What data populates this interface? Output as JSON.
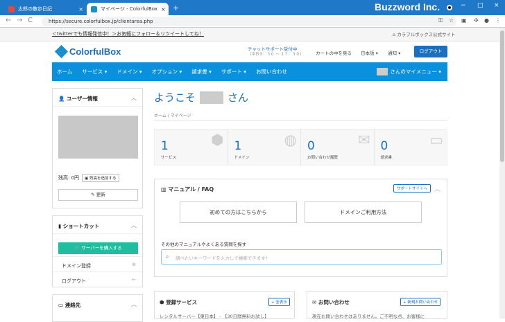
{
  "browser": {
    "tabs": [
      {
        "title": "太郎の散歩日記",
        "close": "×"
      },
      {
        "title": "マイページ - ColorfulBox",
        "close": "×"
      }
    ],
    "new_tab": "+",
    "brand": "Buzzword Inc.",
    "window_buttons": [
      "−",
      "□",
      "×"
    ],
    "url": "https://secure.colorfulbox.jp/clientarea.php",
    "nav": [
      "←",
      "→",
      "C"
    ]
  },
  "infobar": {
    "left": "＜twitterでも情報発信中！＞お気軽にフォロー＆リツイートしてね！",
    "right": "カラフルボックス公式サイト"
  },
  "header": {
    "logo": "ColorfulBox",
    "chat_label": "チャットサポート受付中",
    "chat_hours": "（平日９：３０ ～ １７：３０）",
    "cart": "カートの中を見る",
    "lang": "日本語 ▾",
    "notify": "通知 ▾",
    "logout": "ログアウト"
  },
  "menu": {
    "items": [
      "ホーム",
      "サービス ▾",
      "ドメイン ▾",
      "オプション ▾",
      "請求書 ▾",
      "サポート ▾",
      "お問い合わせ"
    ],
    "mypage": "さんのマイメニュー ▾"
  },
  "user_panel": {
    "title": "ユーザー情報",
    "balance": "残高: 0円",
    "balance_btn": "残高を追加する",
    "refresh": "更新"
  },
  "shortcut_panel": {
    "title": "ショートカット",
    "buy": "サーバーを購入する",
    "items": [
      {
        "label": "ドメイン登録",
        "icon": "globe-icon",
        "glyph": "⊕"
      },
      {
        "label": "ログアウト",
        "icon": "arrow-left-icon",
        "glyph": "←"
      }
    ]
  },
  "contact_panel": {
    "title": "連絡先"
  },
  "main": {
    "welcome_prefix": "ようこそ",
    "welcome_suffix": "さん",
    "breadcrumb": "ホーム  /  マイページ",
    "stats": [
      {
        "num": "1",
        "label": "サービス",
        "icon": "box-icon",
        "glyph": "⬢"
      },
      {
        "num": "1",
        "label": "ドメイン",
        "icon": "globe-icon",
        "glyph": "◍"
      },
      {
        "num": "0",
        "label": "お問い合わせ履歴",
        "icon": "chat-icon",
        "glyph": "✉"
      },
      {
        "num": "0",
        "label": "請求書",
        "icon": "card-icon",
        "glyph": "▭"
      }
    ]
  },
  "manual": {
    "title": "マニュアル / FAQ",
    "support_site": "サポートサイトへ",
    "btn1": "初めての方はこちらから",
    "btn2": "ドメインご利用方法",
    "question": "その他のマニュアルやよくある質問を探す",
    "search_placeholder": "調べたいキーワードを入力して検索できます！"
  },
  "services_card": {
    "title": "登録サービス",
    "button": "+ 全表示",
    "body": "レンタルサーバー【東日本】 - 【30日間無料お試し】"
  },
  "contact_card": {
    "title": "お問い合わせ",
    "button": "+ 新規お問い合わせ",
    "body": "現在お問い合わせはありません。ご不明な点、お客様に"
  },
  "colors": {
    "accent": "#0a91de",
    "brand": "#1a6fc0",
    "buy": "#1ebfa0",
    "chrome": "#1f78c8"
  }
}
